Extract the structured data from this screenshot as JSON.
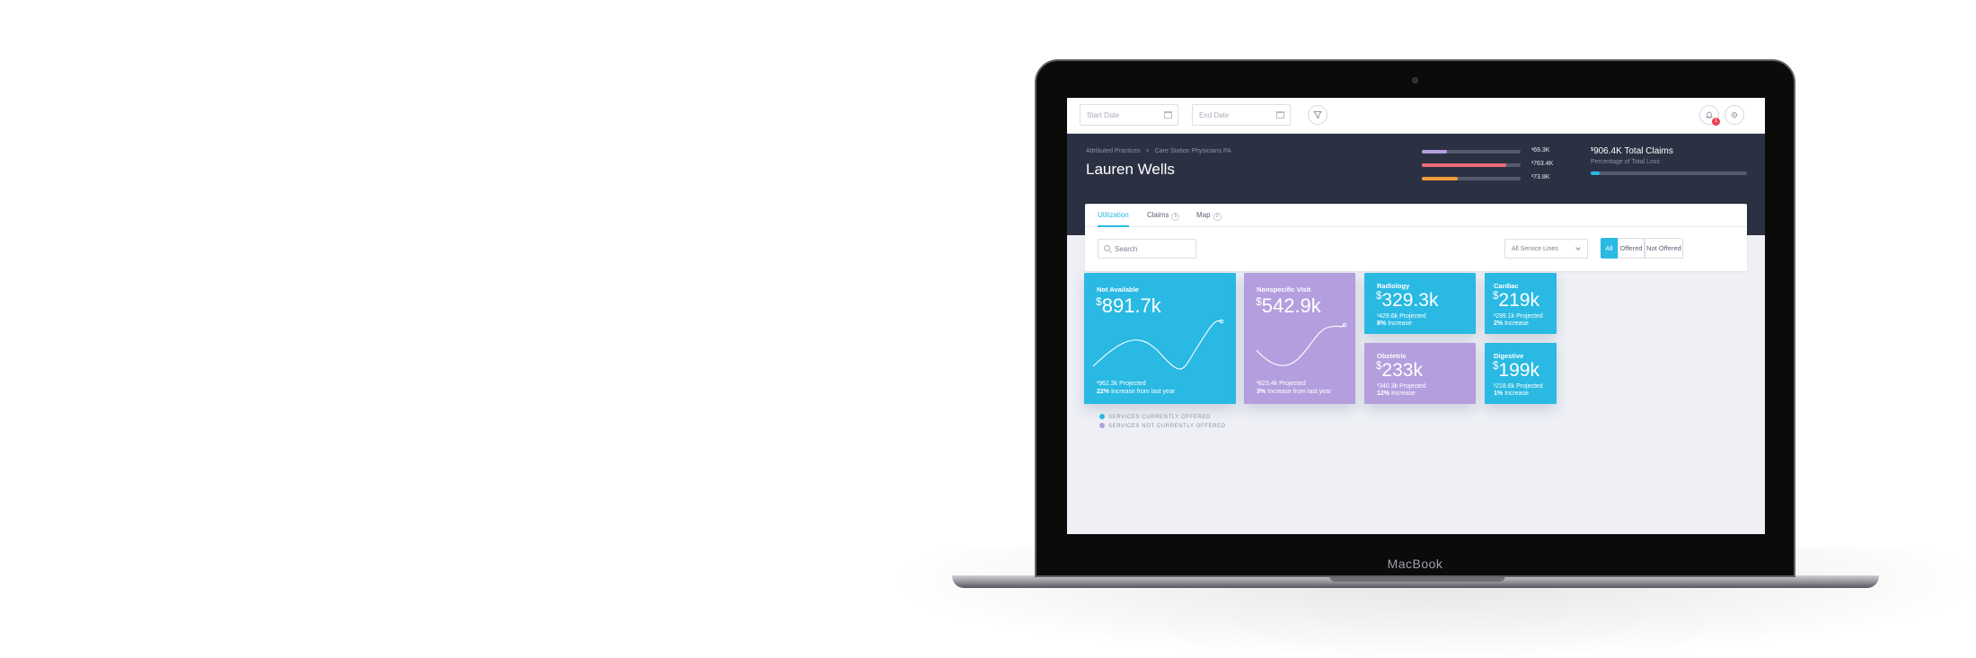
{
  "device": {
    "brand": "MacBook"
  },
  "topbar": {
    "start_date_placeholder": "Start Date",
    "end_date_placeholder": "End Date",
    "notification_count": "1"
  },
  "header": {
    "breadcrumb": [
      "Attributed Practices",
      ">",
      "Care Station Physicians PA"
    ],
    "user_name": "Lauren Wells",
    "bars": [
      {
        "value": "69.3K",
        "fill": 0.25,
        "color": "#b49ede"
      },
      {
        "value": "763.4K",
        "fill": 0.85,
        "color": "#ef6a7a"
      },
      {
        "value": "73.8K",
        "fill": 0.36,
        "color": "#f29a3b"
      }
    ],
    "total_claims": "906.4K Total Claims",
    "total_claims_sub": "Percentage of Total Loss",
    "loss_fill": 0.06
  },
  "tabs": [
    {
      "label": "Utilization",
      "count": "",
      "active": true
    },
    {
      "label": "Claims",
      "count": "5",
      "active": false
    },
    {
      "label": "Map",
      "count": "3",
      "active": false
    }
  ],
  "filters": {
    "search_placeholder": "Search",
    "service_lines": "All Service Lines",
    "segments": [
      "All",
      "Offered",
      "Not Offered"
    ]
  },
  "cards": [
    {
      "title": "Not Available",
      "value": "891.7k",
      "projected": "962.3k",
      "projected_label": "Projected",
      "increase": "22%",
      "increase_label": "Increase from last year",
      "color": "blue"
    },
    {
      "title": "Nonspecific Visit",
      "value": "542.9k",
      "projected": "823.4k",
      "projected_label": "Projected",
      "increase": "3%",
      "increase_label": "Increase from last year",
      "color": "purple"
    },
    {
      "title": "Radiology",
      "value": "329.3k",
      "projected": "429.6k",
      "projected_label": "Projected",
      "increase": "8%",
      "increase_label": "Increase",
      "color": "blue"
    },
    {
      "title": "Cardiac",
      "value": "219k",
      "projected": "299.1k",
      "projected_label": "Projected",
      "increase": "2%",
      "increase_label": "Increase",
      "color": "blue"
    },
    {
      "title": "Obstetric",
      "value": "233k",
      "projected": "340.3k",
      "projected_label": "Projected",
      "increase": "12%",
      "increase_label": "Increase",
      "color": "purple"
    },
    {
      "title": "Digestive",
      "value": "199k",
      "projected": "218.6k",
      "projected_label": "Projected",
      "increase": "1%",
      "increase_label": "Increase",
      "color": "blue"
    }
  ],
  "legend": {
    "offered": "SERVICES CURRENTLY OFFERED",
    "not_offered": "SERVICES NOT CURRENTLY OFFERED",
    "offered_color": "#29b9e3",
    "not_offered_color": "#b49ede"
  }
}
